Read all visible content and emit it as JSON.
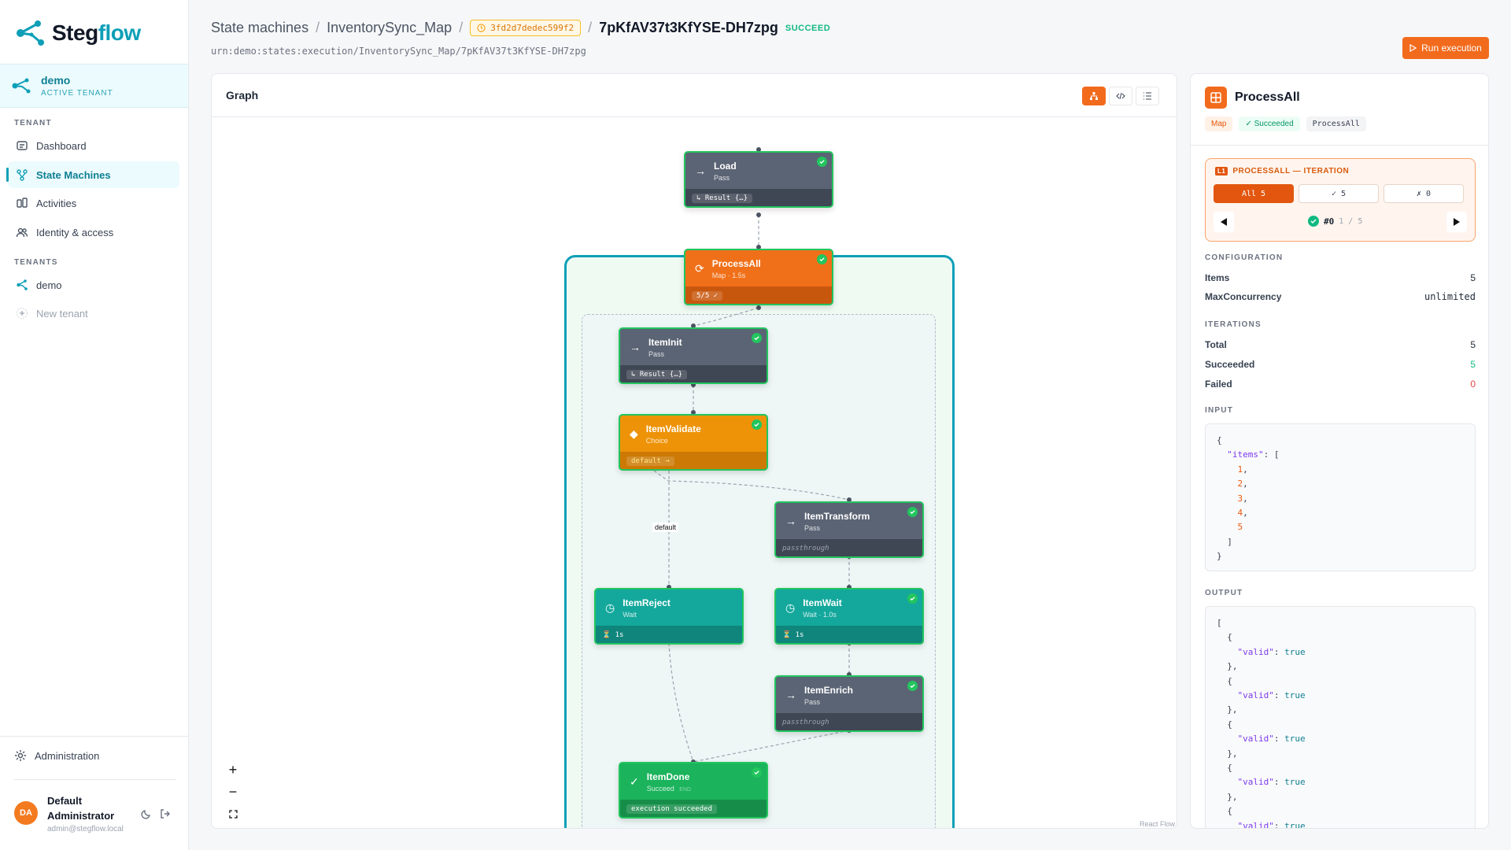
{
  "app": {
    "brand_a": "Steg",
    "brand_b": "flow"
  },
  "tenant": {
    "name": "demo",
    "subtitle": "ACTIVE TENANT"
  },
  "sidebar": {
    "tenant_section": "TENANT",
    "items": [
      {
        "label": "Dashboard",
        "icon": "dashboard-icon"
      },
      {
        "label": "State Machines",
        "icon": "state-machine-icon",
        "active": true
      },
      {
        "label": "Activities",
        "icon": "activities-icon"
      },
      {
        "label": "Identity & access",
        "icon": "users-icon"
      }
    ],
    "tenants_section": "TENANTS",
    "tenants": [
      {
        "label": "demo"
      }
    ],
    "new_tenant": "New tenant",
    "administration": "Administration"
  },
  "user": {
    "initials": "DA",
    "name": "Default Administrator",
    "email": "admin@stegflow.local"
  },
  "header": {
    "crumb1": "State machines",
    "crumb2": "InventorySync_Map",
    "hash": "3fd2d7dedec599f2",
    "execution_id": "7pKfAV37t3KfYSE-DH7zpg",
    "status": "SUCCEED",
    "urn": "urn:demo:states:execution/InventorySync_Map/7pKfAV37t3KfYSE-DH7zpg",
    "run_button": "Run execution"
  },
  "graph": {
    "title": "Graph",
    "edge_label": "default",
    "attribution": "React Flow",
    "nodes": {
      "load": {
        "title": "Load",
        "sub": "Pass",
        "foot": "↳ Result {…}"
      },
      "processall": {
        "title": "ProcessAll",
        "sub": "Map · 1.5s",
        "foot": "5/5 ✓"
      },
      "iteminit": {
        "title": "ItemInit",
        "sub": "Pass",
        "foot": "↳ Result {…}"
      },
      "itemvalidate": {
        "title": "ItemValidate",
        "sub": "Choice",
        "foot": "default →"
      },
      "itemtransform": {
        "title": "ItemTransform",
        "sub": "Pass",
        "foot": "passthrough"
      },
      "itemreject": {
        "title": "ItemReject",
        "sub": "Wait",
        "foot": "⏳ 1s"
      },
      "itemwait": {
        "title": "ItemWait",
        "sub": "Wait · 1.0s",
        "foot": "⏳ 1s"
      },
      "itemenrich": {
        "title": "ItemEnrich",
        "sub": "Pass",
        "foot": "passthrough"
      },
      "itemdone": {
        "title": "ItemDone",
        "sub": "Succeed",
        "end": "END",
        "foot": "execution succeeded"
      }
    }
  },
  "details": {
    "title": "ProcessAll",
    "chip_type": "Map",
    "chip_status": "✓ Succeeded",
    "chip_name": "ProcessAll",
    "iteration_label": "PROCESSALL — ITERATION",
    "iteration_badge": "L1",
    "filter_all": "All 5",
    "filter_ok": "✓ 5",
    "filter_fail": "✗ 0",
    "current_iter": "#0",
    "iter_pos": "1 / 5",
    "config_label": "CONFIGURATION",
    "items_k": "Items",
    "items_v": "5",
    "maxc_k": "MaxConcurrency",
    "maxc_v": "unlimited",
    "iter_section": "ITERATIONS",
    "total_k": "Total",
    "total_v": "5",
    "succ_k": "Succeeded",
    "succ_v": "5",
    "fail_k": "Failed",
    "fail_v": "0",
    "input_label": "INPUT",
    "output_label": "OUTPUT",
    "input_items": [
      "1",
      "2",
      "3",
      "4",
      "5"
    ]
  },
  "colors": {
    "accent": "#f26b1d",
    "brand": "#0e9fb7",
    "success": "#22c55e",
    "fail": "#ef4444"
  }
}
